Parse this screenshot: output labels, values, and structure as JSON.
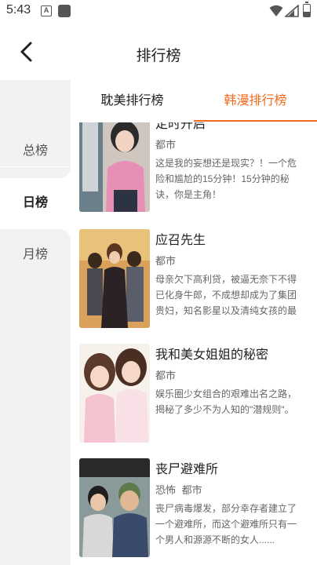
{
  "status": {
    "time": "5:43",
    "icon_a": "A"
  },
  "header": {
    "title": "排行榜",
    "back_icon": "chevron-left-icon"
  },
  "sidebar": {
    "items": [
      {
        "label": "总榜",
        "active": false
      },
      {
        "label": "日榜",
        "active": true
      },
      {
        "label": "月榜",
        "active": false
      }
    ]
  },
  "tabs": [
    {
      "label": "耽美排行榜",
      "active": false
    },
    {
      "label": "韩漫排行榜",
      "active": true
    }
  ],
  "accent_color": "#f26a1b",
  "books": [
    {
      "title": "定时开启",
      "tags": [
        "都市"
      ],
      "desc": "这是我的妄想还是现实？！一个危险和尴尬的15分钟！15分钟的秘诀，你是主角！"
    },
    {
      "title": "应召先生",
      "tags": [
        "都市"
      ],
      "desc": "母亲欠下高利贷，被逼无奈下不得已化身牛郎，不成想却成为了集团贵妇，知名影星以及清纯女孩的最"
    },
    {
      "title": "我和美女姐姐的秘密",
      "tags": [
        "都市"
      ],
      "desc": "娱乐圈少女组合的艰难出名之路，揭秘了多少不为人知的\"潜规则\"。"
    },
    {
      "title": "丧尸避难所",
      "tags": [
        "恐怖",
        "都市"
      ],
      "desc": "丧尸病毒爆发，部分幸存者建立了一个避难所，而这个避难所只有一个男人和源源不断的女人......"
    }
  ]
}
